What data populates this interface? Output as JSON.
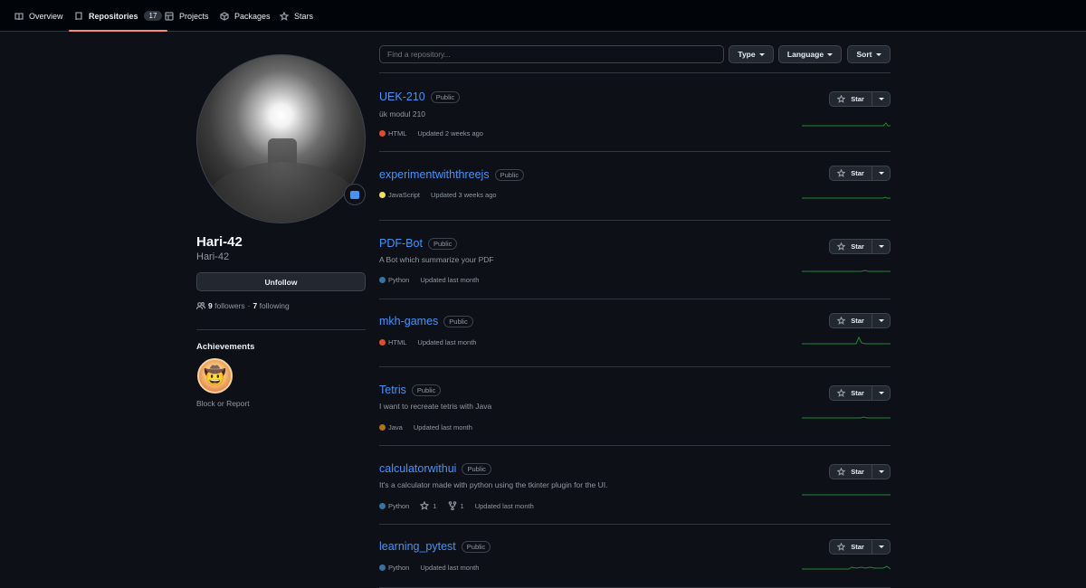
{
  "nav": {
    "tabs": [
      {
        "label": "Overview",
        "icon": "book-icon"
      },
      {
        "label": "Repositories",
        "count": "17",
        "icon": "repo-icon",
        "active": true
      },
      {
        "label": "Projects",
        "icon": "table-icon"
      },
      {
        "label": "Packages",
        "icon": "package-icon"
      },
      {
        "label": "Stars",
        "icon": "star-icon"
      }
    ]
  },
  "profile": {
    "name": "Hari-42",
    "login": "Hari-42",
    "unfollow_label": "Unfollow",
    "followers_count": "9",
    "followers_label": "followers",
    "separator": "·",
    "following_count": "7",
    "following_label": "following",
    "achievements_title": "Achievements",
    "block_report": "Block or Report"
  },
  "filters": {
    "search_placeholder": "Find a repository...",
    "type_label": "Type",
    "language_label": "Language",
    "sort_label": "Sort"
  },
  "repos": [
    {
      "name": "UEK-210",
      "visibility": "Public",
      "description": "ük modul 210",
      "language": "HTML",
      "lang_color": "#e34c26",
      "updated": "Updated 2 weeks ago",
      "stars": "",
      "forks": ""
    },
    {
      "name": "experimentwiththreejs",
      "visibility": "Public",
      "description": "",
      "language": "JavaScript",
      "lang_color": "#f1e05a",
      "updated": "Updated 3 weeks ago",
      "stars": "",
      "forks": ""
    },
    {
      "name": "PDF-Bot",
      "visibility": "Public",
      "description": "A Bot which summarize your PDF",
      "language": "Python",
      "lang_color": "#3572A5",
      "updated": "Updated last month",
      "stars": "",
      "forks": ""
    },
    {
      "name": "mkh-games",
      "visibility": "Public",
      "description": "",
      "language": "HTML",
      "lang_color": "#e34c26",
      "updated": "Updated last month",
      "stars": "",
      "forks": ""
    },
    {
      "name": "Tetris",
      "visibility": "Public",
      "description": "I want to recreate tetris with Java",
      "language": "Java",
      "lang_color": "#b07219",
      "updated": "Updated last month",
      "stars": "",
      "forks": ""
    },
    {
      "name": "calculatorwithui",
      "visibility": "Public",
      "description": "It's a calculator made with python using the tkinter plugin for the UI.",
      "language": "Python",
      "lang_color": "#3572A5",
      "updated": "Updated last month",
      "stars": "1",
      "forks": "1"
    },
    {
      "name": "learning_pytest",
      "visibility": "Public",
      "description": "",
      "language": "Python",
      "lang_color": "#3572A5",
      "updated": "Updated last month",
      "stars": "",
      "forks": ""
    }
  ],
  "star_label": "Star",
  "colors": {
    "accent": "#4493f8",
    "tab_underline": "#fd8c73",
    "sparkline": "#238636"
  }
}
